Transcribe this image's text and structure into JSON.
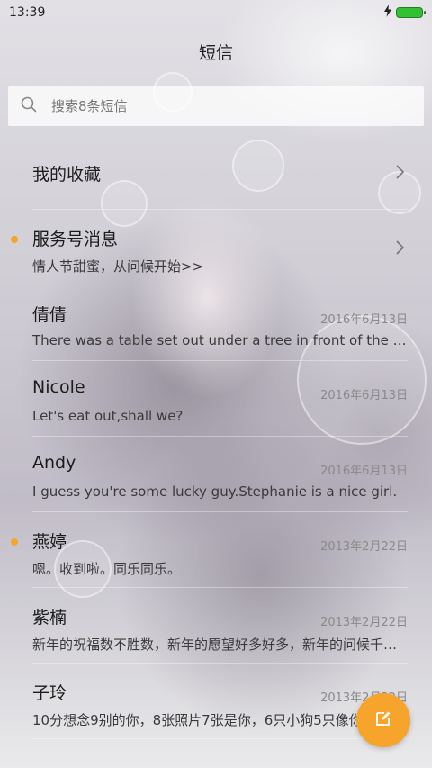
{
  "status_bar": {
    "time": "13:39"
  },
  "header": {
    "title": "短信"
  },
  "search": {
    "placeholder": "搜索8条短信"
  },
  "favorites": {
    "label": "我的收藏"
  },
  "threads": [
    {
      "name": "服务号消息",
      "preview": "情人节甜蜜，从问候开始>>",
      "date": "",
      "unread": true
    },
    {
      "name": "倩倩",
      "preview": "There was a table set out under a tree in front of the house",
      "date": "2016年6月13日",
      "unread": false
    },
    {
      "name": "Nicole",
      "preview": "Let's eat out,shall we?",
      "date": "2016年6月13日",
      "unread": false
    },
    {
      "name": "Andy",
      "preview": "I guess you're some lucky guy.Stephanie is a nice girl.",
      "date": "2016年6月13日",
      "unread": false
    },
    {
      "name": "燕婷",
      "preview": "嗯。收到啦。同乐同乐。",
      "date": "2013年2月22日",
      "unread": true
    },
    {
      "name": "紫楠",
      "preview": "新年的祝福数不胜数，新年的愿望好多好多，新年的问候千千万万",
      "date": "2013年2月22日",
      "unread": false
    },
    {
      "name": "子玲",
      "preview": "10分想念9别的你，8张照片7张是你，6只小狗5只像你",
      "date": "2013年2月22日",
      "unread": false
    }
  ],
  "icons": {
    "search": "search-icon",
    "chevron": "chevron-right-icon",
    "compose": "compose-icon",
    "charging": "charging-icon",
    "battery": "battery-icon"
  },
  "colors": {
    "accent": "#f6a42c",
    "unread_dot": "#f5a623",
    "battery": "#33c033"
  }
}
